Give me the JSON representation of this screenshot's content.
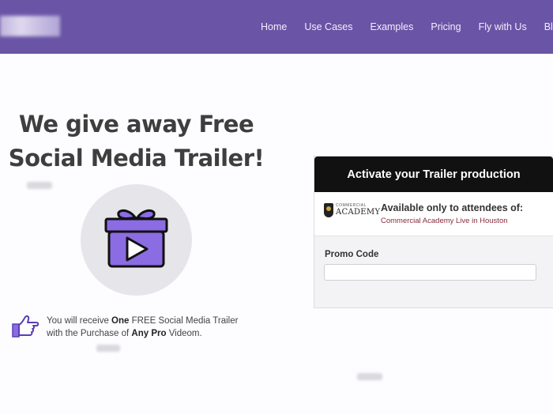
{
  "nav": {
    "items": [
      {
        "label": "Home"
      },
      {
        "label": "Use Cases"
      },
      {
        "label": "Examples"
      },
      {
        "label": "Pricing"
      },
      {
        "label": "Fly with Us"
      },
      {
        "label": "Blog"
      }
    ]
  },
  "hero": {
    "title_line1": "We give away Free",
    "title_line2": "Social Media Trailer!"
  },
  "promo": {
    "text_a": "You will receive ",
    "text_b": "One",
    "text_c": " FREE Social Media Trailer",
    "text_d": "with the Purchase of ",
    "text_e": "Any Pro",
    "text_f": " Videom."
  },
  "card": {
    "header": "Activate your Trailer production",
    "logo_small": "COMMERCIAL",
    "logo_big": "ACADEMY",
    "available_title": "Available only to attendees of:",
    "available_event": "Commercial Academy Live in Houston",
    "promo_label": "Promo Code",
    "promo_value": "",
    "promo_placeholder": ""
  },
  "colors": {
    "nav_bg": "#6a54a6",
    "gift_purple": "#8b6ce3",
    "card_header_bg": "#111111",
    "event_link": "#8a2b3b"
  },
  "icons": {
    "gift": "gift-play-icon",
    "hand": "pointing-hand-icon"
  }
}
